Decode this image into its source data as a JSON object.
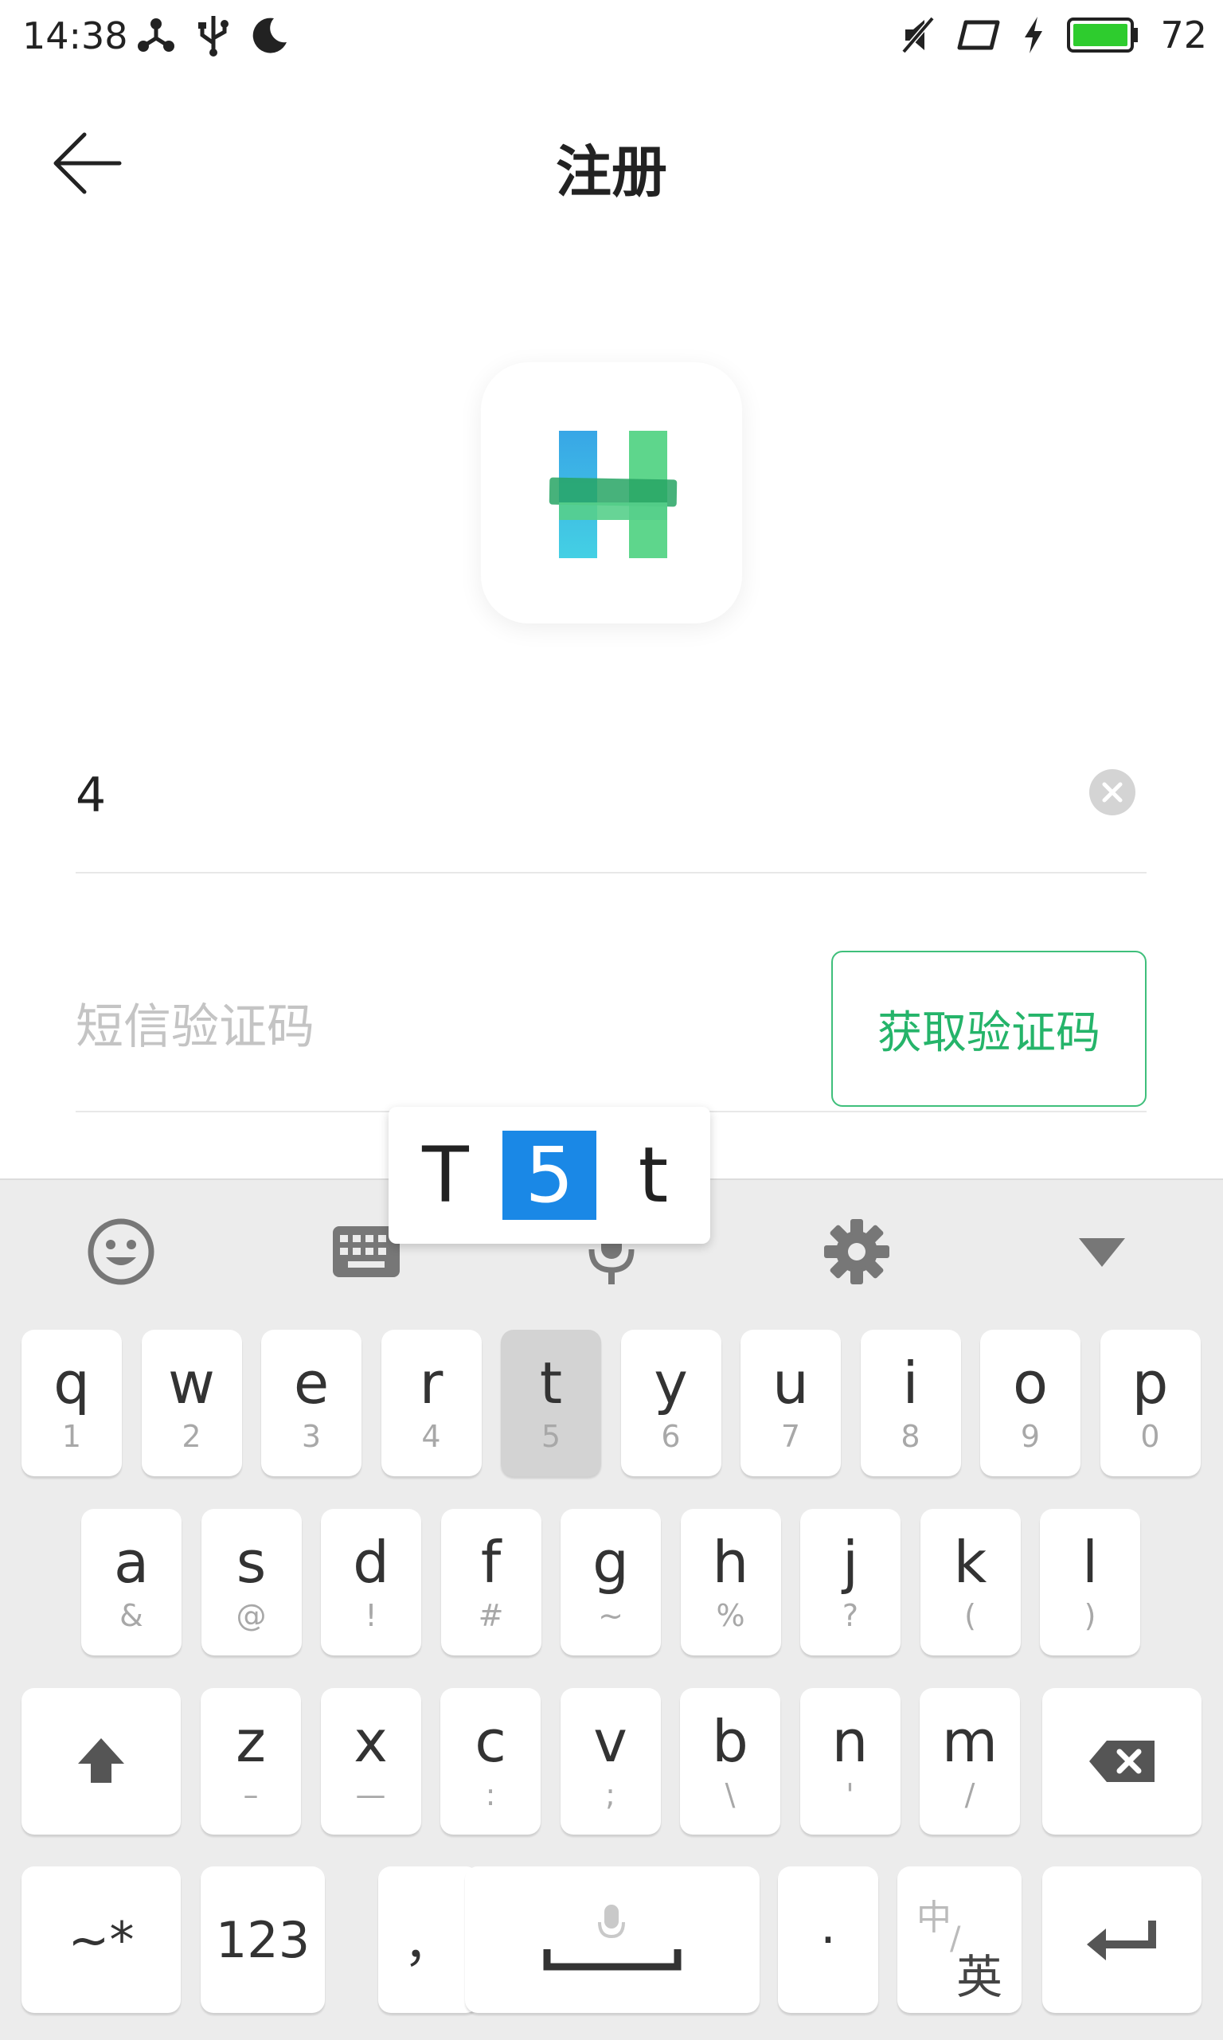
{
  "status_bar": {
    "time": "14:38",
    "left_icons": [
      "share-icon",
      "usb-icon",
      "moon-icon"
    ],
    "right_icons": [
      "mute-icon",
      "screen-icon",
      "charging-icon",
      "battery-icon"
    ],
    "battery_level": "72",
    "battery_color": "#2ecc2e"
  },
  "header": {
    "back_icon": "back-arrow-icon",
    "title": "注册"
  },
  "logo": {
    "letter": "H",
    "colors": [
      "#3fb8e8",
      "#59d48a",
      "#2a9f62"
    ]
  },
  "form": {
    "phone_value": "4",
    "sms_placeholder": "短信验证码",
    "get_code_label": "获取验证码",
    "accent_color": "#25b46a"
  },
  "keyboard": {
    "candidates": [
      "T",
      "5",
      "t"
    ],
    "selected_candidate": "5",
    "toolbar_icons": [
      "emoji-icon",
      "keyboard-icon",
      "mic-icon",
      "settings-icon",
      "hide-keyboard-icon"
    ],
    "row1": [
      {
        "main": "q",
        "sub": "1"
      },
      {
        "main": "w",
        "sub": "2"
      },
      {
        "main": "e",
        "sub": "3"
      },
      {
        "main": "r",
        "sub": "4"
      },
      {
        "main": "t",
        "sub": "5"
      },
      {
        "main": "y",
        "sub": "6"
      },
      {
        "main": "u",
        "sub": "7"
      },
      {
        "main": "i",
        "sub": "8"
      },
      {
        "main": "o",
        "sub": "9"
      },
      {
        "main": "p",
        "sub": "0"
      }
    ],
    "row2": [
      {
        "main": "a",
        "sub": "&"
      },
      {
        "main": "s",
        "sub": "@"
      },
      {
        "main": "d",
        "sub": "!"
      },
      {
        "main": "f",
        "sub": "#"
      },
      {
        "main": "g",
        "sub": "~"
      },
      {
        "main": "h",
        "sub": "%"
      },
      {
        "main": "j",
        "sub": "?"
      },
      {
        "main": "k",
        "sub": "("
      },
      {
        "main": "l",
        "sub": ")"
      }
    ],
    "row3": [
      {
        "main": "z",
        "sub": "–"
      },
      {
        "main": "x",
        "sub": "—"
      },
      {
        "main": "c",
        "sub": ":"
      },
      {
        "main": "v",
        "sub": ";"
      },
      {
        "main": "b",
        "sub": "\\"
      },
      {
        "main": "n",
        "sub": "'"
      },
      {
        "main": "m",
        "sub": "/"
      }
    ],
    "pressed_key": "t",
    "symbols_label": "~*",
    "numbers_label": "123",
    "comma_label": "，",
    "period_label": "·",
    "lang_top": "中",
    "lang_bottom": "英"
  }
}
